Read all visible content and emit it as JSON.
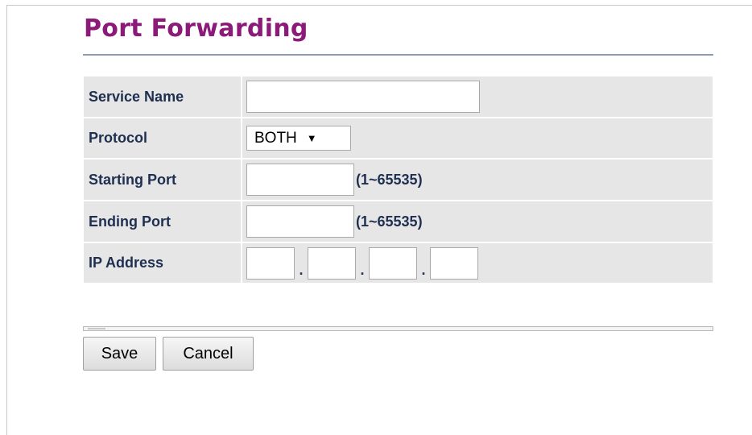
{
  "page": {
    "title": "Port Forwarding"
  },
  "form": {
    "service_name": {
      "label": "Service Name",
      "value": ""
    },
    "protocol": {
      "label": "Protocol",
      "selected": "BOTH",
      "arrow": "▼"
    },
    "starting_port": {
      "label": "Starting Port",
      "value": "",
      "range": "(1~65535)"
    },
    "ending_port": {
      "label": "Ending Port",
      "value": "",
      "range": "(1~65535)"
    },
    "ip_address": {
      "label": "IP Address",
      "octets": [
        "",
        "",
        "",
        ""
      ],
      "separator": "."
    }
  },
  "buttons": {
    "save": "Save",
    "cancel": "Cancel"
  },
  "colors": {
    "title": "#8b1a78",
    "label": "#1f2f50",
    "row_bg": "#e6e6e6",
    "rule": "#8e9cb0"
  }
}
